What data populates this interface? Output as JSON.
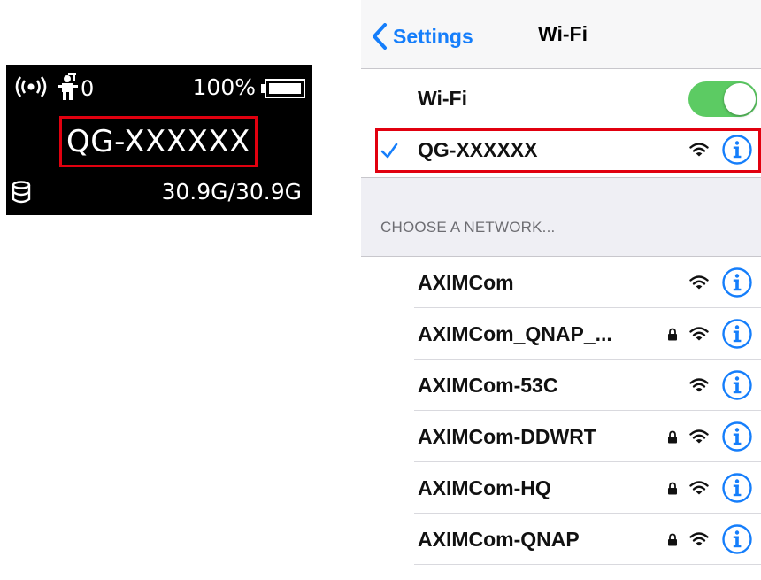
{
  "device": {
    "client_count": "0",
    "battery_level": "100%",
    "ssid": "QG-XXXXXX",
    "data_usage": "30.9G/30.9G",
    "icons": {
      "broadcast": "wireless-broadcast-icon",
      "clients": "connected-user-icon",
      "battery": "battery-full-icon",
      "data": "data-usage-icon"
    }
  },
  "ios": {
    "navbar": {
      "back_label": "Settings",
      "title": "Wi-Fi"
    },
    "wifi_toggle": {
      "label": "Wi-Fi",
      "on": true
    },
    "connected_network": {
      "name": "QG-XXXXXX",
      "checked": true,
      "secured": false
    },
    "section_header": "CHOOSE A NETWORK...",
    "networks": [
      {
        "name": "AXIMCom",
        "secured": false
      },
      {
        "name": "AXIMCom_QNAP_...",
        "secured": true
      },
      {
        "name": "AXIMCom-53C",
        "secured": false
      },
      {
        "name": "AXIMCom-DDWRT",
        "secured": true
      },
      {
        "name": "AXIMCom-HQ",
        "secured": true
      },
      {
        "name": "AXIMCom-QNAP",
        "secured": true
      }
    ]
  },
  "colors": {
    "ios_blue": "#157efb",
    "toggle_green": "#5ccb63",
    "highlight_red": "#e1000f",
    "device_screen": "#000000"
  }
}
